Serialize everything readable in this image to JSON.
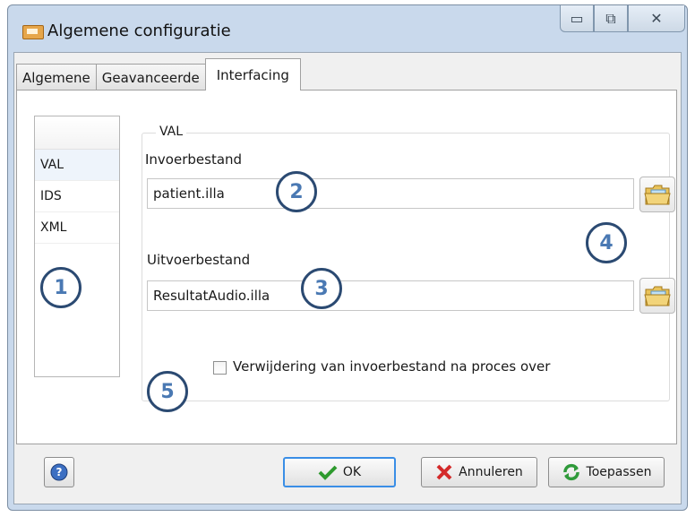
{
  "window": {
    "title": "Algemene configuratie",
    "controls": {
      "minimize": "▭",
      "maximize": "⧉",
      "close": "✕"
    }
  },
  "tabs": [
    {
      "label": "Algemene",
      "active": false
    },
    {
      "label": "Geavanceerde",
      "active": false
    },
    {
      "label": "Interfacing",
      "active": true
    }
  ],
  "list": {
    "items": [
      "VAL",
      "IDS",
      "XML"
    ],
    "selected": "VAL"
  },
  "group": {
    "legend": "VAL"
  },
  "input_file": {
    "label": "Invoerbestand",
    "value": "patient.illa"
  },
  "output_file": {
    "label": "Uitvoerbestand",
    "value": "ResultatAudio.illa"
  },
  "checkbox": {
    "label": "Verwijdering van invoerbestand na proces over",
    "checked": false
  },
  "buttons": {
    "ok": "OK",
    "cancel": "Annuleren",
    "apply": "Toepassen"
  },
  "callouts": [
    "1",
    "2",
    "3",
    "4",
    "5"
  ],
  "icons": {
    "app": "app-icon",
    "folder": "folder-icon",
    "help": "help-icon",
    "ok": "checkmark-icon",
    "cancel": "red-x-icon",
    "apply": "refresh-icon"
  },
  "colors": {
    "callout_border": "#2b4a72",
    "callout_text": "#4a79b3",
    "ok_border": "#3a8ee6"
  }
}
